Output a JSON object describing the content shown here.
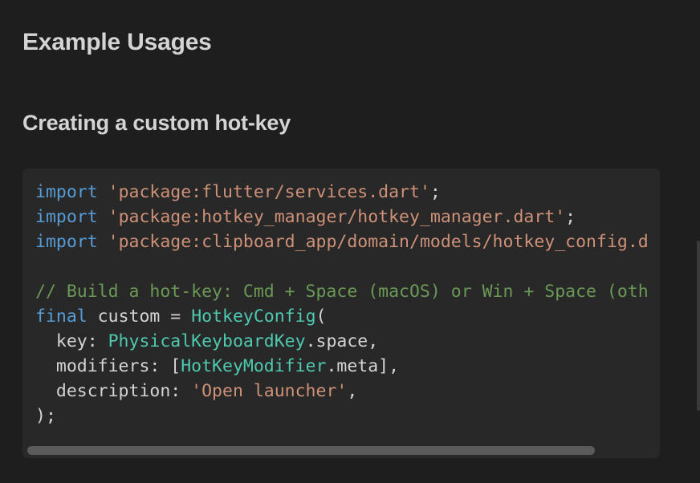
{
  "content": {
    "heading": "Example Usages",
    "subheading": "Creating a custom hot-key"
  },
  "code_block": {
    "language": "dart",
    "lines": [
      [
        {
          "t": "kw",
          "v": "import"
        },
        {
          "t": "pl",
          "v": " "
        },
        {
          "t": "str",
          "v": "'package:flutter/services.dart'"
        },
        {
          "t": "pl",
          "v": ";"
        }
      ],
      [
        {
          "t": "kw",
          "v": "import"
        },
        {
          "t": "pl",
          "v": " "
        },
        {
          "t": "str",
          "v": "'package:hotkey_manager/hotkey_manager.dart'"
        },
        {
          "t": "pl",
          "v": ";"
        }
      ],
      [
        {
          "t": "kw",
          "v": "import"
        },
        {
          "t": "pl",
          "v": " "
        },
        {
          "t": "str",
          "v": "'package:clipboard_app/domain/models/hotkey_config.d"
        }
      ],
      [],
      [
        {
          "t": "cm",
          "v": "// Build a hot-key: Cmd + Space (macOS) or Win + Space (oth"
        }
      ],
      [
        {
          "t": "kw",
          "v": "final"
        },
        {
          "t": "pl",
          "v": " custom = "
        },
        {
          "t": "ty",
          "v": "HotkeyConfig"
        },
        {
          "t": "pl",
          "v": "("
        }
      ],
      [
        {
          "t": "pl",
          "v": "  key: "
        },
        {
          "t": "ty",
          "v": "PhysicalKeyboardKey"
        },
        {
          "t": "pl",
          "v": ".space,"
        }
      ],
      [
        {
          "t": "pl",
          "v": "  modifiers: ["
        },
        {
          "t": "ty",
          "v": "HotKeyModifier"
        },
        {
          "t": "pl",
          "v": ".meta],"
        }
      ],
      [
        {
          "t": "pl",
          "v": "  description: "
        },
        {
          "t": "str",
          "v": "'Open launcher'"
        },
        {
          "t": "pl",
          "v": ","
        }
      ],
      [
        {
          "t": "pl",
          "v": ");"
        }
      ]
    ]
  },
  "colors": {
    "background": "#1e1e1e",
    "code_background": "#282828",
    "keyword": "#569cd6",
    "string": "#ce9178",
    "comment": "#6a9955",
    "type": "#4ec9b0",
    "plain": "#d4d4d4"
  }
}
